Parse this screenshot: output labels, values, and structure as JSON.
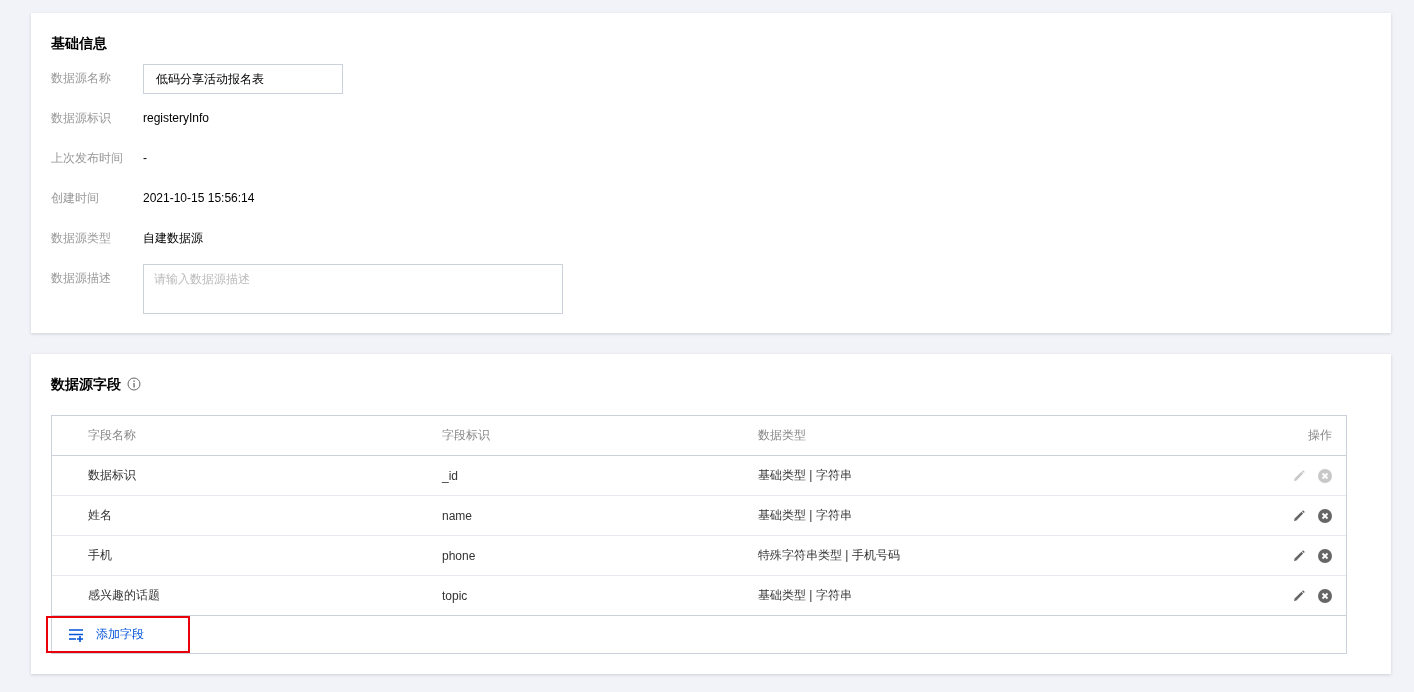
{
  "basic_info": {
    "title": "基础信息",
    "fields": [
      {
        "kind": "input",
        "label": "数据源名称",
        "value": "低码分享活动报名表"
      },
      {
        "kind": "text",
        "label": "数据源标识",
        "value": "registeryInfo"
      },
      {
        "kind": "text",
        "label": "上次发布时间",
        "value": "-"
      },
      {
        "kind": "text",
        "label": "创建时间",
        "value": "2021-10-15 15:56:14"
      },
      {
        "kind": "text",
        "label": "数据源类型",
        "value": "自建数据源"
      },
      {
        "kind": "textarea",
        "label": "数据源描述",
        "placeholder": "请输入数据源描述"
      }
    ]
  },
  "fields_section": {
    "title": "数据源字段",
    "table": {
      "columns": [
        "字段名称",
        "字段标识",
        "数据类型",
        "操作"
      ],
      "rows": [
        {
          "name": "数据标识",
          "id": "_id",
          "type": "基础类型 | 字符串",
          "disabled": true
        },
        {
          "name": "姓名",
          "id": "name",
          "type": "基础类型 | 字符串",
          "disabled": false
        },
        {
          "name": "手机",
          "id": "phone",
          "type": "特殊字符串类型 | 手机号码",
          "disabled": false
        },
        {
          "name": "感兴趣的话题",
          "id": "topic",
          "type": "基础类型 | 字符串",
          "disabled": false
        }
      ]
    },
    "add_button": {
      "label": "添加字段",
      "highlighted": true
    }
  }
}
